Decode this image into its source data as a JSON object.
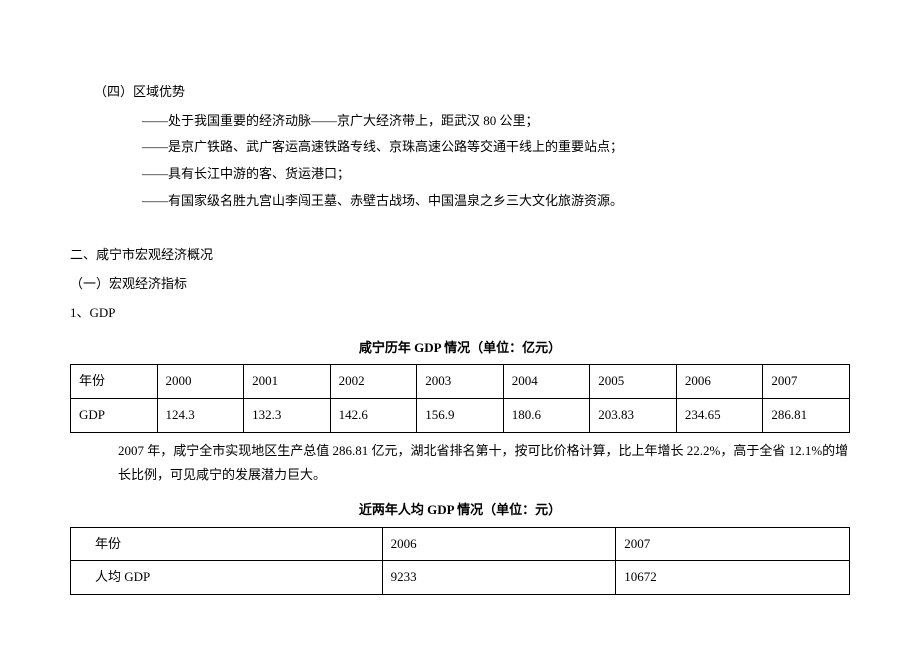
{
  "sec4_title": "（四）区域优势",
  "bullets": [
    "——处于我国重要的经济动脉——京广大经济带上，距武汉 80 公里；",
    "——是京广铁路、武广客运高速铁路专线、京珠高速公路等交通干线上的重要站点；",
    "——具有长江中游的客、货运港口；",
    "——有国家级名胜九宫山李闯王墓、赤壁古战场、中国温泉之乡三大文化旅游资源。"
  ],
  "sec2_title": "二、咸宁市宏观经济概况",
  "sub1_title": "（一）宏观经济指标",
  "item1_title": "1、GDP",
  "table1_title": "咸宁历年 GDP 情况（单位：亿元）",
  "table1": {
    "row1": [
      "年份",
      "2000",
      "2001",
      "2002",
      "2003",
      "2004",
      "2005",
      "2006",
      "2007"
    ],
    "row2": [
      "GDP",
      "124.3",
      "132.3",
      "142.6",
      "156.9",
      "180.6",
      "203.83",
      "234.65",
      "286.81"
    ]
  },
  "paragraph": "2007 年，咸宁全市实现地区生产总值 286.81 亿元，湖北省排名第十，按可比价格计算，比上年增长 22.2%，高于全省 12.1%的增长比例，可见咸宁的发展潜力巨大。",
  "table2_title": "近两年人均 GDP 情况（单位：元）",
  "table2": {
    "row1": [
      "年份",
      "2006",
      "2007"
    ],
    "row2": [
      "人均 GDP",
      "9233",
      "10672"
    ]
  },
  "chart_data": [
    {
      "type": "table",
      "title": "咸宁历年 GDP 情况（单位：亿元）",
      "categories": [
        "2000",
        "2001",
        "2002",
        "2003",
        "2004",
        "2005",
        "2006",
        "2007"
      ],
      "series": [
        {
          "name": "GDP",
          "values": [
            124.3,
            132.3,
            142.6,
            156.9,
            180.6,
            203.83,
            234.65,
            286.81
          ]
        }
      ],
      "xlabel": "年份",
      "ylabel": "GDP（亿元）"
    },
    {
      "type": "table",
      "title": "近两年人均 GDP 情况（单位：元）",
      "categories": [
        "2006",
        "2007"
      ],
      "series": [
        {
          "name": "人均 GDP",
          "values": [
            9233,
            10672
          ]
        }
      ],
      "xlabel": "年份",
      "ylabel": "人均 GDP（元）"
    }
  ]
}
